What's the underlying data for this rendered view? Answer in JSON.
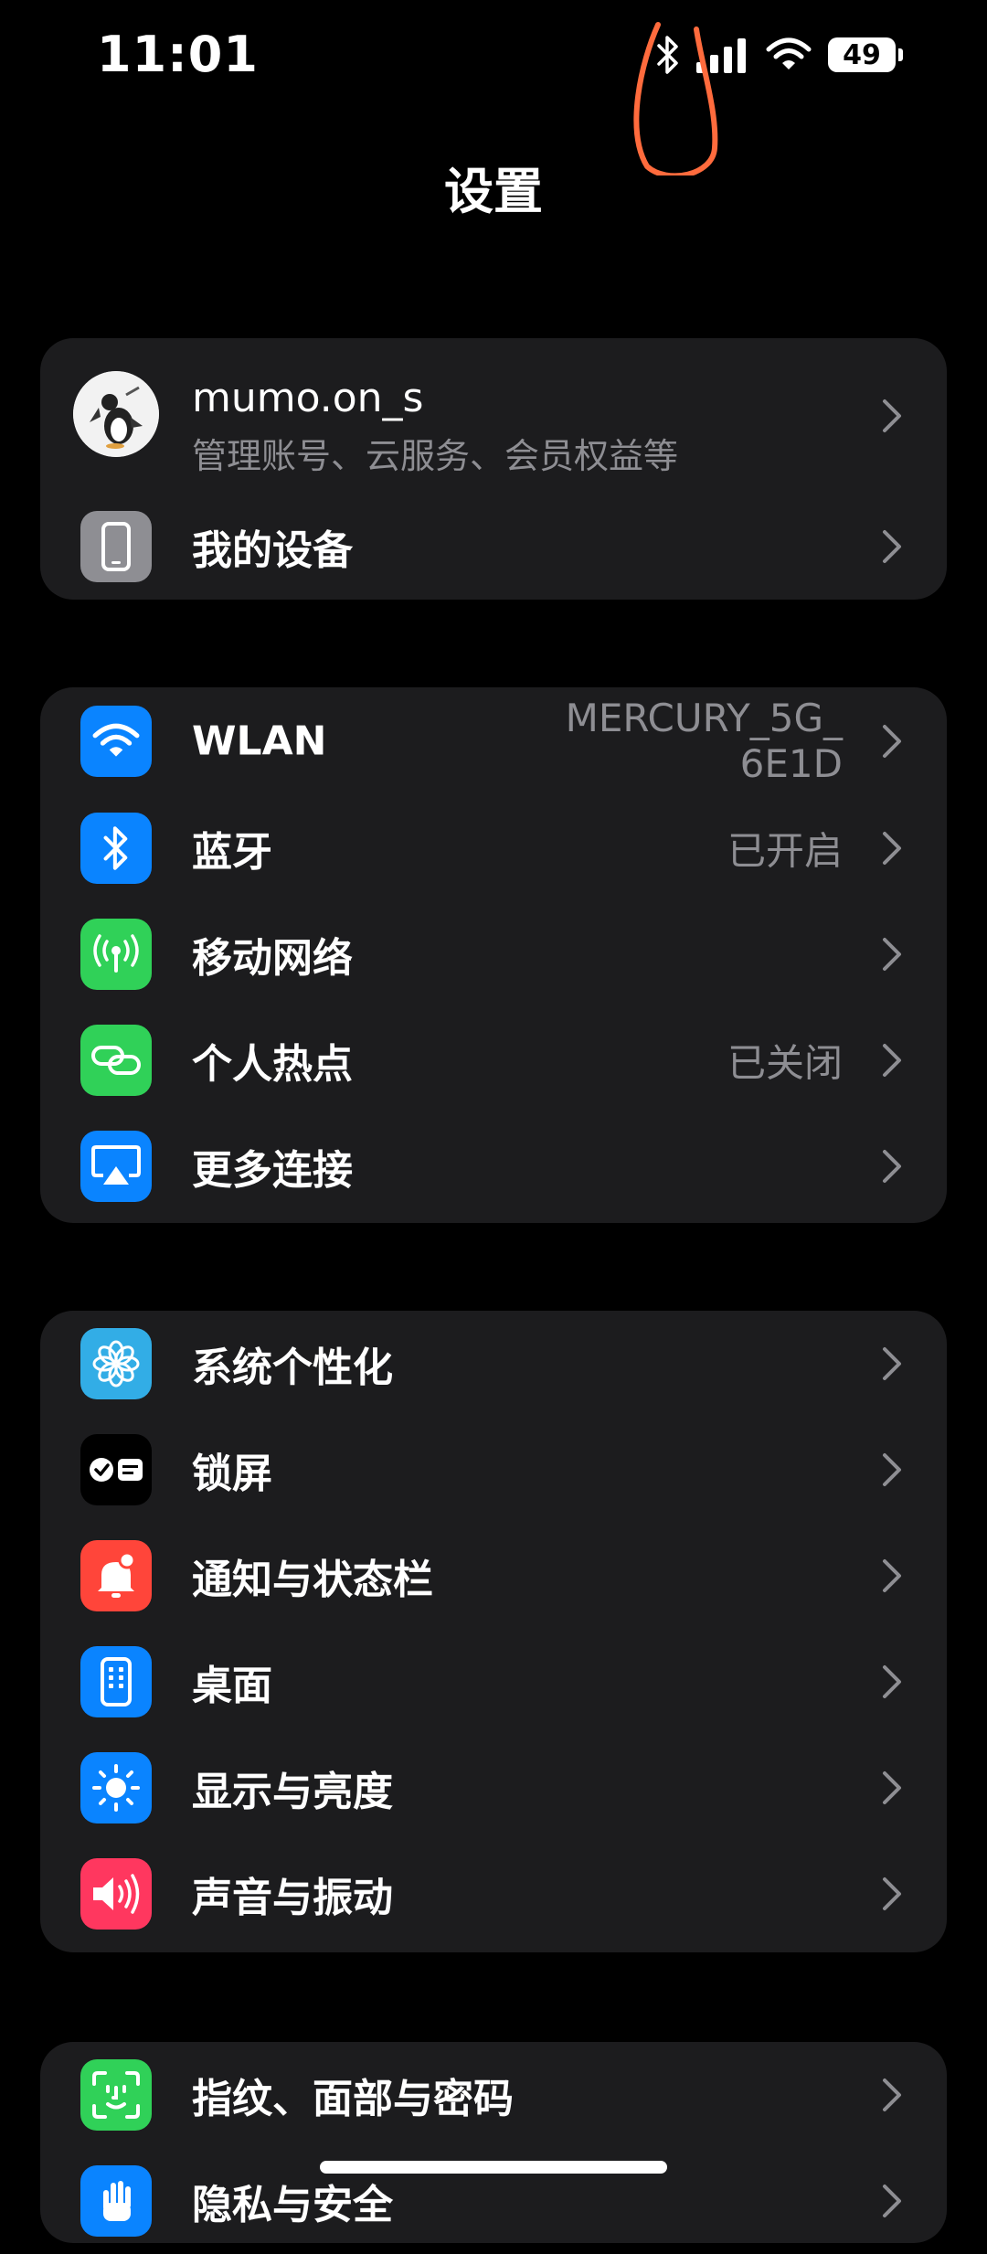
{
  "status_bar": {
    "time": "11:01",
    "battery": "49",
    "icons": [
      "bluetooth-icon",
      "cellular-signal-icon",
      "wifi-icon",
      "battery-icon"
    ]
  },
  "header": {
    "title": "设置"
  },
  "account": {
    "name": "mumo.on_s",
    "subtitle": "管理账号、云服务、会员权益等"
  },
  "my_device": {
    "label": "我的设备"
  },
  "connections": [
    {
      "label": "WLAN",
      "value_line1": "MERCURY_5G_",
      "value_line2": "6E1D",
      "icon": "wifi-icon",
      "color": "#0a84ff"
    },
    {
      "label": "蓝牙",
      "value": "已开启",
      "icon": "bluetooth-icon",
      "color": "#0a84ff"
    },
    {
      "label": "移动网络",
      "value": "",
      "icon": "antenna-icon",
      "color": "#30d158"
    },
    {
      "label": "个人热点",
      "value": "已关闭",
      "icon": "hotspot-link-icon",
      "color": "#30d158"
    },
    {
      "label": "更多连接",
      "value": "",
      "icon": "airplay-icon",
      "color": "#0a84ff"
    }
  ],
  "personalization": [
    {
      "label": "系统个性化",
      "icon": "flower-icon",
      "color": "#32ade6"
    },
    {
      "label": "锁屏",
      "icon": "lock-screen-icon",
      "color": "#000000"
    },
    {
      "label": "通知与状态栏",
      "icon": "bell-icon",
      "color": "#ff453a"
    },
    {
      "label": "桌面",
      "icon": "home-screen-icon",
      "color": "#0a84ff"
    },
    {
      "label": "显示与亮度",
      "icon": "sun-icon",
      "color": "#0a84ff"
    },
    {
      "label": "声音与振动",
      "icon": "speaker-icon",
      "color": "#ff375f"
    }
  ],
  "security": [
    {
      "label": "指纹、面部与密码",
      "icon": "face-id-icon",
      "color": "#30d158"
    },
    {
      "label": "隐私与安全",
      "icon": "hand-icon",
      "color": "#0a84ff"
    }
  ]
}
